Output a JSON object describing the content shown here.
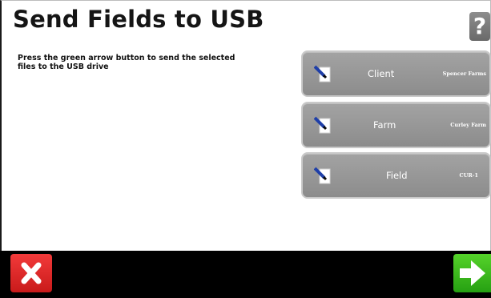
{
  "header": {
    "title": "Send Fields to USB",
    "help_label": "?"
  },
  "instruction": {
    "text": "Press the green arrow button to send the selected files to the USB drive"
  },
  "fields": [
    {
      "label": "Client",
      "value": "Spencer Farms",
      "icon": "document-pen-icon"
    },
    {
      "label": "Farm",
      "value": "Curley Farm",
      "icon": "document-pen-icon"
    },
    {
      "label": "Field",
      "value": "CUR-1",
      "icon": "document-pen-icon"
    }
  ],
  "footer": {
    "cancel_icon": "close-icon",
    "confirm_icon": "arrow-right-icon"
  },
  "colors": {
    "button_gray": "#999999",
    "cancel_red": "#e02424",
    "confirm_green": "#3cbd1e",
    "bottom_bar": "#000000"
  }
}
